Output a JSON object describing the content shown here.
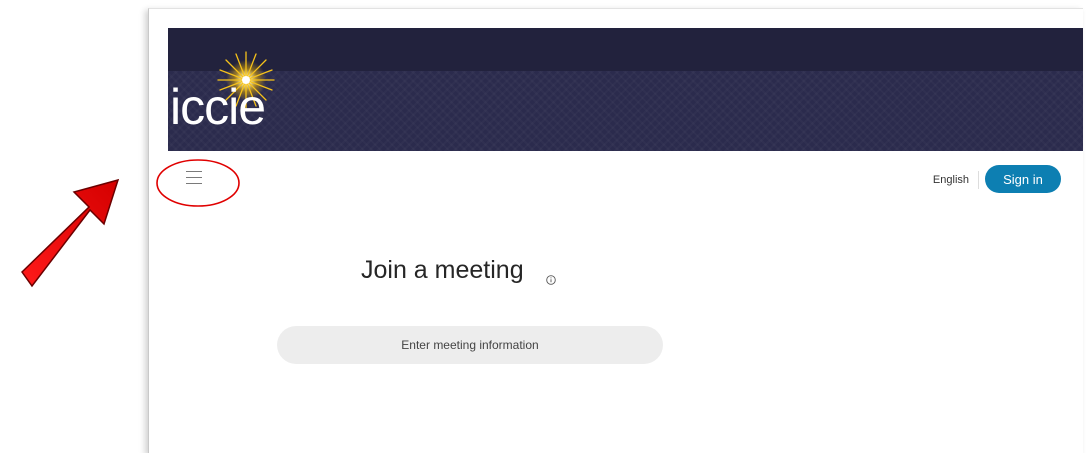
{
  "banner": {
    "logo_text": "iccie",
    "colors": {
      "dark": "#22223d",
      "mid": "#2b2b4d"
    }
  },
  "toolbar": {
    "menu_icon": "hamburger-menu-icon",
    "language": "English",
    "sign_in_label": "Sign in",
    "sign_in_color": "#0d7fb2"
  },
  "main": {
    "title": "Join a meeting",
    "info_icon": "info-icon",
    "input_placeholder": "Enter meeting information"
  },
  "annotations": {
    "arrow_color": "#e0000f",
    "circle_color": "#e00000",
    "arrow_icon": "red-arrow-icon",
    "circle_icon": "red-circle-highlight"
  }
}
